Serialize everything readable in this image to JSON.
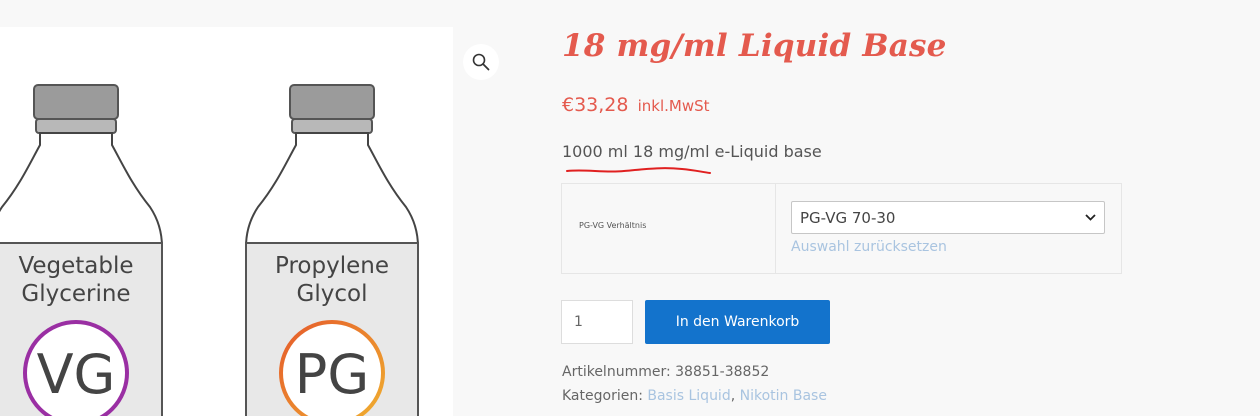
{
  "gallery": {
    "zoom_icon": "magnifier-icon",
    "bottles": [
      {
        "line1": "Vegetable",
        "line2": "Glycerine",
        "abbr": "VG",
        "ring_color": "#9a2fa3"
      },
      {
        "line1": "Propylene",
        "line2": "Glycol",
        "abbr": "PG",
        "ring_colors": [
          "#e55a2b",
          "#f0b030"
        ]
      }
    ]
  },
  "product": {
    "title": "18 mg/ml Liquid Base",
    "price": "€33,28",
    "tax_note": "inkl.MwSt",
    "short_description": "1000 ml 18 mg/ml e-Liquid base",
    "annotation_color": "#e02020"
  },
  "variation": {
    "label": "PG-VG Verhältnis",
    "selected": "PG-VG 70-30",
    "reset_label": "Auswahl zurücksetzen"
  },
  "cart": {
    "quantity": "1",
    "button_label": "In den Warenkorb"
  },
  "meta": {
    "sku_label": "Artikelnummer:",
    "sku_value": "38851-38852",
    "categories_label": "Kategorien:",
    "categories": [
      "Basis Liquid",
      "Nikotin Base"
    ],
    "separator": ","
  },
  "colors": {
    "accent": "#e45a4e",
    "button": "#1373cc",
    "link": "#a9c4e0"
  }
}
